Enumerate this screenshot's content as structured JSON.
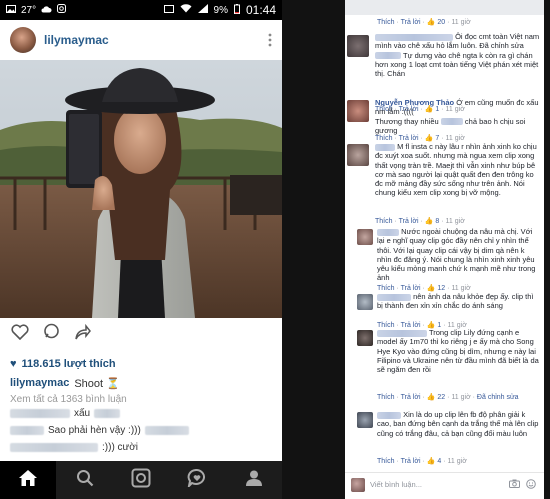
{
  "phone": {
    "status": {
      "temp": "27°",
      "battery": "9%",
      "time": "01:44"
    },
    "header": {
      "username": "lilymaymac"
    },
    "likes": "118.615 lượt thích",
    "caption": {
      "user": "lilymaymac",
      "text": "Shoot ⏳"
    },
    "view_all": "Xem tất cả 1363 bình luận",
    "comments": [
      {
        "text": "xấu"
      },
      {
        "text": "Sao phải hèn vậy :)))"
      },
      {
        "text": ":))) cười"
      }
    ],
    "nav": [
      "home-icon",
      "search-icon",
      "camera-icon",
      "activity-icon",
      "profile-icon"
    ]
  },
  "fb": {
    "top": {
      "meta_thich": "Thích",
      "meta_reply": "Trả lời",
      "meta_like": "👍 20",
      "meta_time": "11 giờ"
    },
    "comments": [
      {
        "text": "Ôi đọc cmt toàn Việt nam mình vào chê xấu hỏ lắm luôn. Đã chỉnh sửa",
        "text2": "Tự dưng vào chê ngta k còn ra gì chán hơn xong 1 loạt cmt toàn tiếng Việt phán xét miệt thị. Chán",
        "meta": [
          "Thích",
          "Trả lời",
          "👍 1",
          "11 giờ"
        ]
      },
      {
        "name": "Nguyễn Phương Thảo",
        "text": "Ớ em cũng muốn đc xấu nm lắm :((((",
        "text2": "Thương thay nhiều",
        "text3": "chả bao h chịu soi gương",
        "meta": [
          "Thích",
          "Trả lời",
          "👍 7",
          "11 giờ"
        ]
      },
      {
        "text": "M fl insta c này lâu r nhìn ảnh xinh ko chịu đc xuýt xoa suốt. nhưng mà ngua xem clip xong thất vọng tràn trề. Maejt thì vẫn xinh như búp bê cơ mà sao người lại quật quất đen đen trông ko đc mỡ mảng đầy sức sống như trên ảnh. Nói chung kiểu xem clip xong bị vỡ mộng.",
        "meta": [
          "Thích",
          "Trả lời",
          "👍 8",
          "11 giờ"
        ]
      },
      {
        "text": "Nước ngoài chuộng da nâu mà chị. Với lại e nghĩ quay clip góc đầy nên chỉ y nhìn thể thôi. Với lại quay clip cái vậy bị dim qà nên k nhìn đc đăng ý. Nói chung là nhìn xinh xinh yêu yêu kiểu mỏng manh chứ k mạnh mẽ như trong ảnh",
        "meta": [
          "Thích",
          "Trả lời",
          "👍 12",
          "11 giờ"
        ]
      },
      {
        "text": "nên ảnh da nâu khỏe đẹp ấy. clip thì bị thành đen xỉn xỉn chắc do ánh sáng",
        "meta": [
          "Thích",
          "Trả lời",
          "👍 1",
          "11 giờ"
        ]
      },
      {
        "text": "Trong clip Lily đứng cạnh e model ấy 1m70 thì ko riêng j e ấy mà cho Song Hye Kyo vào đứng cũng bị dìm, nhưng e này lai Filipino và Ukraine nên từ đầu mình đã biết là da sẽ ngăm đen rồi",
        "meta": [
          "Thích",
          "Trả lời",
          "👍 22",
          "11 giờ",
          "Đã chỉnh sửa"
        ]
      },
      {
        "text": "Xin là do up clip lên fb độ phân giải k cao, ban đứng bên cạnh da trắng thế mà lên clip cũng có trắng đâu, cả bạn cũng đổi màu luôn",
        "meta": [
          "Thích",
          "Trả lời",
          "👍 4",
          "11 giờ"
        ]
      }
    ],
    "reply_placeholder": "Viết bình luận...",
    "reply_icons": [
      "camera-icon",
      "emoji-icon"
    ]
  }
}
